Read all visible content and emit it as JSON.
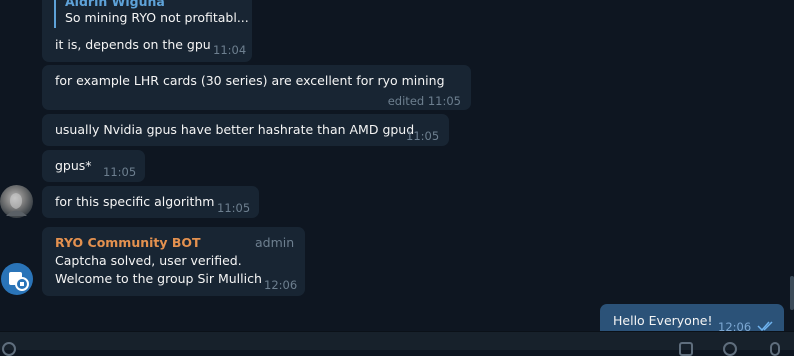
{
  "messages": [
    {
      "reply": {
        "author": "Aldrin Wiguna",
        "preview": "So mining RYO not profitabl..."
      },
      "text": "it is, depends on the gpu",
      "time": "11:04"
    },
    {
      "text": "for example LHR cards (30 series) are excellent for ryo mining",
      "time": "edited 11:05"
    },
    {
      "text": "usually Nvidia gpus have better hashrate than AMD gpud",
      "time": "11:05"
    },
    {
      "text": "gpus*",
      "time": "11:05"
    },
    {
      "text": "for this specific algorithm",
      "time": "11:05"
    },
    {
      "author": "RYO Community BOT",
      "role": "admin",
      "line1": "Captcha solved, user verified.",
      "line2": "Welcome to the group Sir Mullich",
      "time": "12:06"
    },
    {
      "text": "Hello Everyone!",
      "time": "12:06",
      "status_icon": "double-check-icon"
    }
  ],
  "icons": [
    "user-avatar",
    "bot-avatar",
    "double-check-icon",
    "attach-icon",
    "emoji-icon",
    "mic-icon"
  ],
  "colors": {
    "background": "#0e1621",
    "incoming_bubble": "#182533",
    "outgoing_bubble": "#2b5278",
    "bot_name": "#e4914f",
    "reply_accent": "#5ea2d8"
  }
}
